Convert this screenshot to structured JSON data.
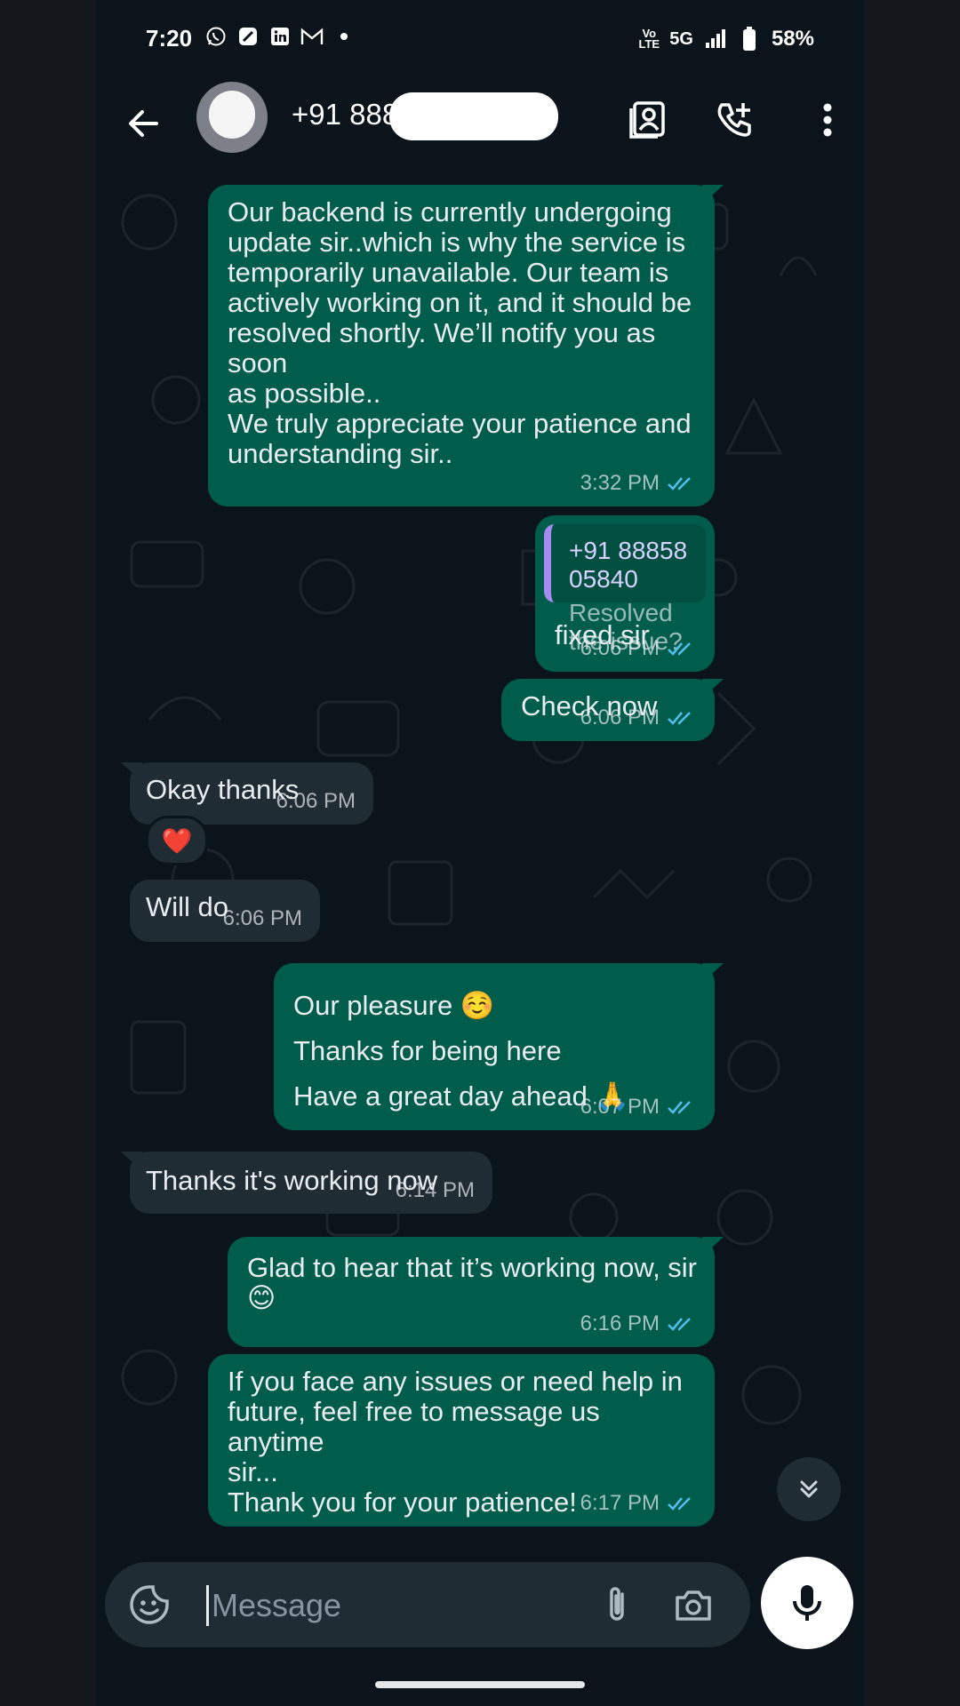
{
  "status_bar": {
    "time": "7:20",
    "network": "5G",
    "battery": "58%"
  },
  "header": {
    "contact": "+91 888"
  },
  "messages": [
    {
      "dir": "out",
      "text": "Our backend is currently undergoing\nupdate sir..which is why the service is\ntemporarily unavailable. Our team is\nactively working on it, and it should be\nresolved shortly. We’ll notify you as soon\nas possible..\nWe truly appreciate your patience and\nunderstanding sir..",
      "time": "3:32 PM"
    },
    {
      "dir": "out",
      "quote_name": "+91 88858 05840",
      "quote_text": "Resolved the issue?",
      "text": "fixed sir",
      "time": "6:06 PM"
    },
    {
      "dir": "out",
      "text": "Check now",
      "time": "6:06 PM"
    },
    {
      "dir": "in",
      "text": "Okay thanks",
      "time": "6:06 PM",
      "reaction": "❤️"
    },
    {
      "dir": "in",
      "text": "Will do",
      "time": "6:06 PM"
    },
    {
      "dir": "out",
      "text": "Our pleasure ☺️\nThanks for being here\nHave a great day ahead 🙏",
      "time": "6:07 PM"
    },
    {
      "dir": "in",
      "text": "Thanks it's working now",
      "time": "6:14 PM"
    },
    {
      "dir": "out",
      "text": "Glad to hear that it’s working now, sir 😊",
      "time": "6:16 PM"
    },
    {
      "dir": "out",
      "text": "If you face any issues or need help in\nfuture, feel free to message us anytime\nsir...\nThank you for your patience!",
      "time": "6:17 PM"
    }
  ],
  "composer": {
    "placeholder": "Message"
  },
  "colors": {
    "outgoing_bubble": "#005c4b",
    "incoming_bubble": "#202c33",
    "read_ticks": "#53bdeb",
    "background": "#0b141a"
  }
}
